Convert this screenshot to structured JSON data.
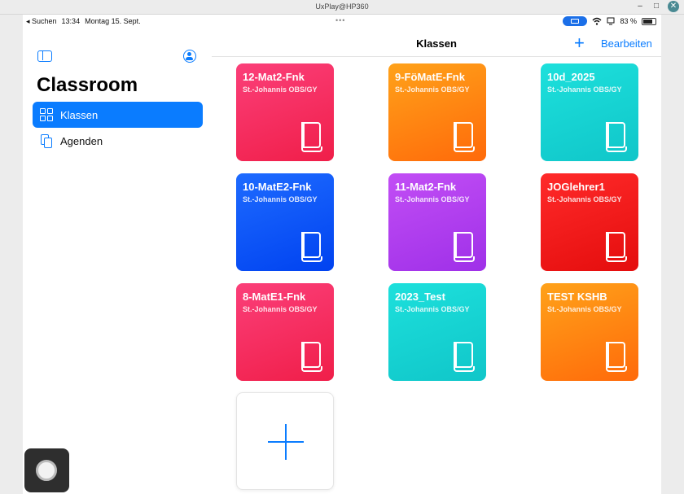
{
  "window": {
    "title": "UxPlay@HP360",
    "minimize": "–",
    "maximize": "□",
    "close": "✕"
  },
  "statusbar": {
    "back": "◂ Suchen",
    "time": "13:34",
    "date": "Montag 15. Sept.",
    "dots": "•••",
    "wifi": "wifi-icon",
    "battery_pct": "83 %"
  },
  "sidebar": {
    "title": "Classroom",
    "items": [
      {
        "label": "Klassen",
        "icon": "grid-icon",
        "active": true
      },
      {
        "label": "Agenden",
        "icon": "documents-icon",
        "active": false
      }
    ]
  },
  "navbar": {
    "title": "Klassen",
    "add": "+",
    "edit": "Bearbeiten"
  },
  "classes": [
    {
      "name": "12-Mat2-Fnk",
      "school": "St.-Johannis OBS/GY",
      "gradient": [
        "#fb3f79",
        "#f01e49"
      ]
    },
    {
      "name": "9-FöMatE-Fnk",
      "school": "St.-Johannis OBS/GY",
      "gradient": [
        "#ffa21a",
        "#ff6a0a"
      ]
    },
    {
      "name": "10d_2025",
      "school": "St.-Johannis OBS/GY",
      "gradient": [
        "#1de0dc",
        "#10c6c9"
      ]
    },
    {
      "name": "10-MatE2-Fnk",
      "school": "St.-Johannis OBS/GY",
      "gradient": [
        "#1e6bff",
        "#0042f0"
      ]
    },
    {
      "name": "11-Mat2-Fnk",
      "school": "St.-Johannis OBS/GY",
      "gradient": [
        "#c24ef5",
        "#9f30e8"
      ]
    },
    {
      "name": "JOGlehrer1",
      "school": "St.-Johannis OBS/GY",
      "gradient": [
        "#ff2a2a",
        "#e40d0d"
      ]
    },
    {
      "name": "8-MatE1-Fnk",
      "school": "St.-Johannis OBS/GY",
      "gradient": [
        "#fb3f79",
        "#f01e49"
      ]
    },
    {
      "name": "2023_Test",
      "school": "St.-Johannis OBS/GY",
      "gradient": [
        "#1de0dc",
        "#10c6c9"
      ]
    },
    {
      "name": "TEST KSHB",
      "school": "St.-Johannis OBS/GY",
      "gradient": [
        "#ffa21a",
        "#ff6a0a"
      ]
    }
  ],
  "add_class_icon": "plus-icon",
  "assistive_touch_icon": "assistive-touch-icon"
}
